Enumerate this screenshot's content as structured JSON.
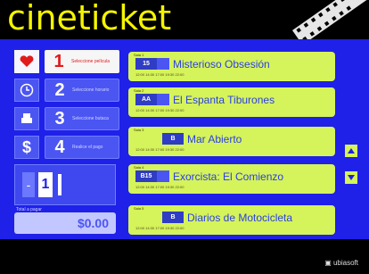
{
  "header": {
    "logo": "cineticket"
  },
  "steps": [
    {
      "icon": "heart-icon",
      "number": "1",
      "label": "Seleccione película",
      "active": true
    },
    {
      "icon": "clock-icon",
      "number": "2",
      "label": "Seleccione horario",
      "active": false
    },
    {
      "icon": "seat-icon",
      "number": "3",
      "label": "Seleccione butaca",
      "active": false
    },
    {
      "icon": "dollar-icon",
      "number": "4",
      "label": "Realice el pago",
      "active": false
    }
  ],
  "quantity": {
    "value": "1",
    "decrement": "-"
  },
  "total": {
    "label": "Total a pagar",
    "value": "$0.00"
  },
  "movies": [
    {
      "tag": "Sala 1",
      "title": "Misterioso Obsesión",
      "rating": "15"
    },
    {
      "tag": "Sala 2",
      "title": "El Espanta Tiburones",
      "rating": "AA"
    },
    {
      "tag": "Sala 3",
      "title": "Mar Abierto",
      "rating": "B"
    },
    {
      "tag": "Sala 4",
      "title": "Exorcista: El Comienzo",
      "rating": "B15"
    },
    {
      "tag": "Sala 5",
      "title": "Diarios de Motocicleta",
      "rating": "B"
    }
  ],
  "showtimes": "12:00   14:30   17:00   19:30   22:00",
  "footer": {
    "brand": "▣ ubiasoft"
  }
}
